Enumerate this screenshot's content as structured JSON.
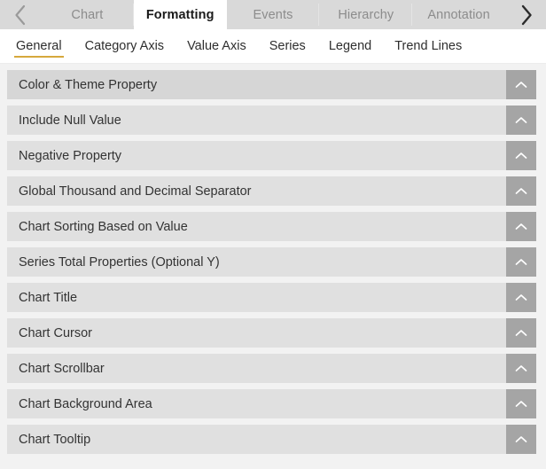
{
  "topbar": {
    "prev_arrow": "chevron-left",
    "next_arrow": "chevron-right",
    "tabs": [
      {
        "label": "Chart",
        "active": false
      },
      {
        "label": "Formatting",
        "active": true
      },
      {
        "label": "Events",
        "active": false
      },
      {
        "label": "Hierarchy",
        "active": false
      },
      {
        "label": "Annotation",
        "active": false
      }
    ]
  },
  "subtabs": [
    {
      "label": "General",
      "active": true
    },
    {
      "label": "Category Axis",
      "active": false
    },
    {
      "label": "Value Axis",
      "active": false
    },
    {
      "label": "Series",
      "active": false
    },
    {
      "label": "Legend",
      "active": false
    },
    {
      "label": "Trend Lines",
      "active": false
    }
  ],
  "accordion": {
    "collapse_icon": "chevron-up-icon",
    "rows": [
      {
        "label": "Color & Theme Property",
        "highlight": true
      },
      {
        "label": "Include Null Value",
        "highlight": false
      },
      {
        "label": "Negative Property",
        "highlight": false
      },
      {
        "label": "Global Thousand and Decimal Separator",
        "highlight": false
      },
      {
        "label": "Chart Sorting Based on Value",
        "highlight": false
      },
      {
        "label": "Series Total Properties (Optional Y)",
        "highlight": false
      },
      {
        "label": "Chart Title",
        "highlight": false
      },
      {
        "label": "Chart Cursor",
        "highlight": false
      },
      {
        "label": "Chart Scrollbar",
        "highlight": false
      },
      {
        "label": "Chart Background Area",
        "highlight": false
      },
      {
        "label": "Chart Tooltip",
        "highlight": false
      }
    ]
  },
  "colors": {
    "page_background": "#f2f2f2",
    "tabbar_background": "#d9d9d9",
    "active_tab_background": "#ffffff",
    "subtab_accent": "#d6a83c",
    "row_background": "#e0e0e0",
    "row_highlight_background": "#d6d6d6",
    "toggle_background": "#a5a5a5",
    "label_text": "#333333",
    "inactive_tab_text": "#8c8c8c"
  }
}
